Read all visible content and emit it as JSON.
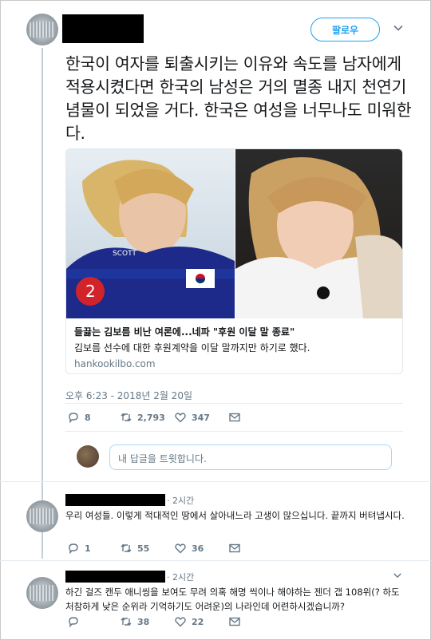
{
  "tweet": {
    "follow_label": "팔로우",
    "text": "한국이 여자를 퇴출시키는 이유와 속도를 남자에게 적용시켰다면 한국의 남성은 거의 멸종 내지 천연기념물이 되었을 거다. 한국은 여성을 너무나도 미워한다.",
    "card": {
      "title": "들끓는 김보름 비난 여론에...네파 \"후원 이달 말 종료\"",
      "description": "김보름 선수에 대한 후원계약을 이달 말까지만 하기로 했다.",
      "domain": "hankookilbo.com"
    },
    "timestamp": "오후 6:23 - 2018년 2월 20일",
    "reply_count": "8",
    "retweet_count": "2,793",
    "like_count": "347"
  },
  "reply_box": {
    "placeholder": "내 답글을 트윗합니다."
  },
  "replies": [
    {
      "time": "· 2시간",
      "text": "우리 여성들. 이렇게 적대적인 땅에서 살아내느라 고생이 많으십니다. 끝까지 버텨냅시다.",
      "reply_count": "1",
      "retweet_count": "55",
      "like_count": "36"
    },
    {
      "time": "· 2시간",
      "text": "하긴 걸즈 캔두 애니씽을 보여도 무려 의혹 해명 씩이나 해야하는 젠더 갭 108위(? 하도 처참하게 낮은 순위라 기억하기도 어려운)의 나라인데 어련하시겠습니까?",
      "reply_count": "",
      "retweet_count": "38",
      "like_count": "22"
    }
  ],
  "icons": {
    "reply": "reply-icon",
    "retweet": "retweet-icon",
    "like": "heart-icon",
    "dm": "envelope-icon",
    "more": "chevron-down-icon"
  },
  "colors": {
    "accent": "#1da1f2",
    "muted": "#657786",
    "text": "#14171a"
  }
}
